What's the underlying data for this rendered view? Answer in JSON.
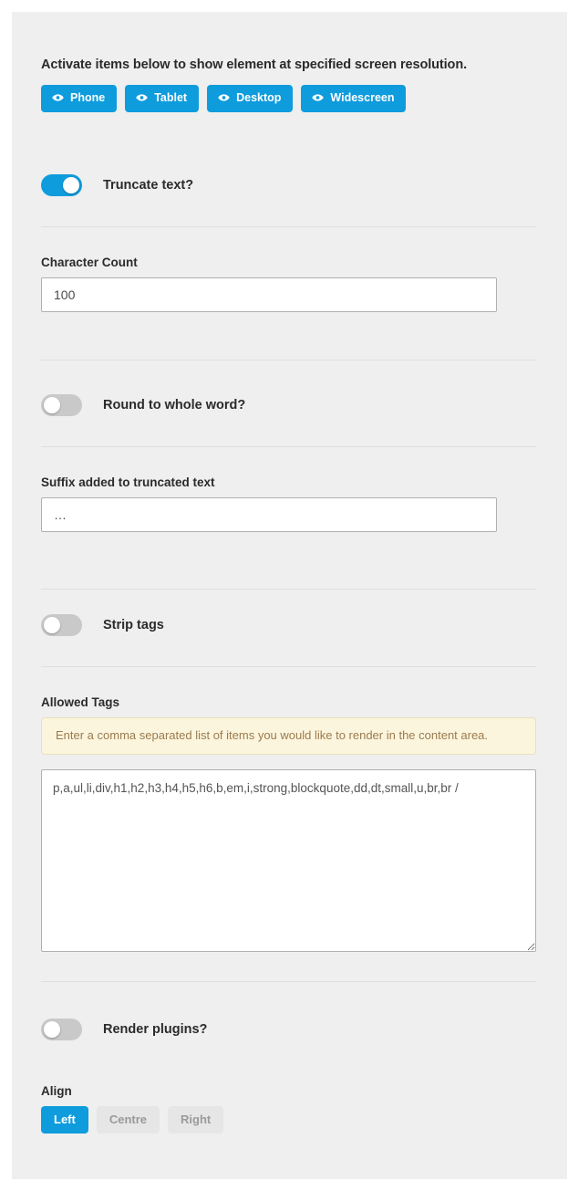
{
  "panel": {
    "intro_text": "Activate items below to show element at specified screen resolution."
  },
  "resolution_buttons": [
    {
      "label": "Phone",
      "icon": "eye-icon"
    },
    {
      "label": "Tablet",
      "icon": "eye-icon"
    },
    {
      "label": "Desktop",
      "icon": "eye-icon"
    },
    {
      "label": "Widescreen",
      "icon": "eye-icon"
    }
  ],
  "truncate": {
    "label": "Truncate text?",
    "state": "on"
  },
  "character_count": {
    "label": "Character Count",
    "value": "100"
  },
  "round_word": {
    "label": "Round to whole word?",
    "state": "off"
  },
  "suffix": {
    "label": "Suffix added to truncated text",
    "value": "…"
  },
  "strip_tags": {
    "label": "Strip tags",
    "state": "off"
  },
  "allowed_tags": {
    "label": "Allowed Tags",
    "help": "Enter a comma separated list of items you would like to render in the content area.",
    "value": "p,a,ul,li,div,h1,h2,h3,h4,h5,h6,b,em,i,strong,blockquote,dd,dt,small,u,br,br /"
  },
  "render_plugins": {
    "label": "Render plugins?",
    "state": "off"
  },
  "align": {
    "label": "Align",
    "options": [
      "Left",
      "Centre",
      "Right"
    ],
    "selected": "Left"
  },
  "colors": {
    "accent": "#0e9cdd",
    "panel_bg": "#efefef",
    "help_bg": "#fcf5dd",
    "help_text": "#9a7b4f",
    "toggle_off": "#c9c9c9"
  }
}
